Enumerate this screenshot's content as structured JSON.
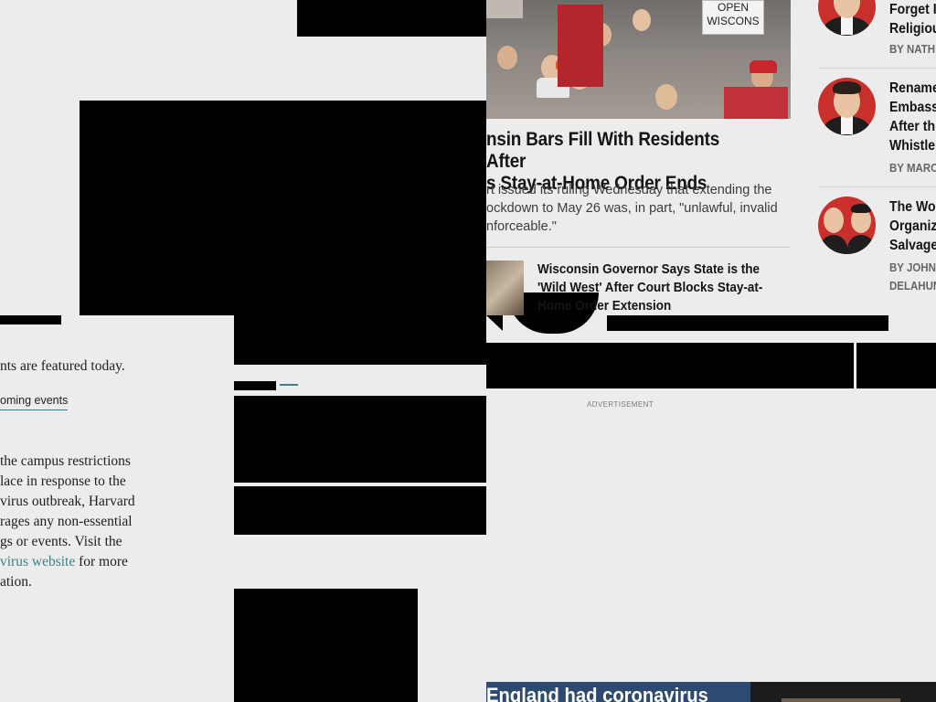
{
  "left_column": {
    "intro_text": "nts are featured today.",
    "upcoming_link": "oming events",
    "notice_lines": [
      "the campus restrictions",
      "lace in response to the",
      "virus outbreak, Harvard",
      "rages any non-essential",
      "gs or events. Visit the"
    ],
    "notice_link": "virus website",
    "notice_after_link": " for more",
    "notice_last_line": "ation."
  },
  "main_article": {
    "hero_sign_text": "OPEN WISCONS",
    "headline_line1": "nsin Bars Fill With Residents After",
    "headline_line2": "s Stay-at-Home Order Ends",
    "summary_line1": "rt issued its ruling Wednesday that extending the",
    "summary_line2": "ockdown to May 26 was, in part, \"unlawful, invalid",
    "summary_line3": "nforceable.\"",
    "related_headline_line1": "Wisconsin Governor Says State is the",
    "related_headline_line2": "'Wild West' After Court Blocks Stay-at-",
    "related_headline_line3": "Home Order Extension"
  },
  "sidebar_stories": [
    {
      "title_lines": [
        "Forget I",
        "Religiou"
      ],
      "byline": "BY NATH"
    },
    {
      "title_lines": [
        "Rename",
        "Embass",
        "After th",
        "Whistle"
      ],
      "byline": "BY MARC"
    },
    {
      "title_lines": [
        "The Wo",
        "Organiz",
        "Salvage"
      ],
      "byline_lines": [
        "BY JOHN",
        "DELAHUN"
      ]
    }
  ],
  "advertisement_label": "ADVERTISEMENT",
  "bottom_banner_text": "England had coronavirus",
  "colors": {
    "background": "#ececec",
    "link_teal": "#3f7f8c",
    "avatar_red": "#c9302c",
    "banner_blue": "#2f4a70"
  }
}
